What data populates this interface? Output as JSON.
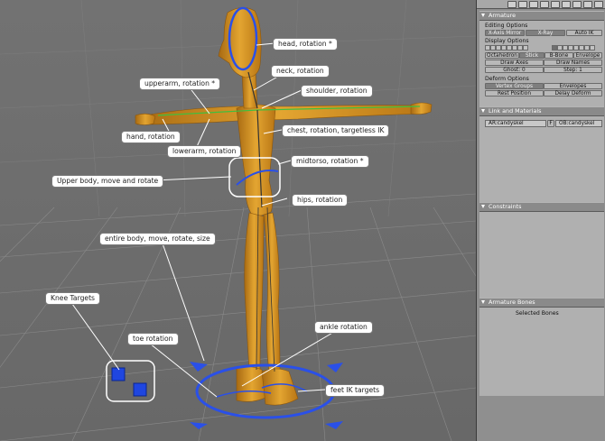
{
  "callouts": {
    "head": "head, rotation *",
    "neck": "neck, rotation",
    "upperarm": "upperarm, rotation *",
    "shoulder": "shoulder, rotation",
    "hand": "hand, rotation",
    "chest": "chest, rotation, targetless IK",
    "lowerarm": "lowerarm, rotation",
    "midtorso": "midtorso, rotation *",
    "upper_body": "Upper body, move and rotate",
    "hips": "hips, rotation",
    "entire_body": "entire body, move, rotate, size",
    "knee_targets": "Knee Targets",
    "ankle": "ankle rotation",
    "toe": "toe rotation",
    "feet_ik": "feet IK targets"
  },
  "panel": {
    "armature": {
      "title": "Armature",
      "editing_options": "Editing Options",
      "x_axis_mirror": "X-Axis Mirror",
      "x_ray": "X-Ray",
      "auto_ik": "Auto IK",
      "display_options": "Display Options",
      "octahedron": "Octahedron",
      "stick": "Stick",
      "b_bone": "B-Bone",
      "envelope": "Envelope",
      "draw_axes": "Draw Axes",
      "draw_names": "Draw Names",
      "ghost": "Ghost: 0",
      "step": "Step: 1",
      "deform_options": "Deform Options",
      "vertex_groups": "Vertex Groups",
      "envelopes": "Envelopes",
      "rest_position": "Rest Position",
      "delay_deform": "Delay Deform"
    },
    "link_materials": {
      "title": "Link and Materials",
      "ar_field": "AR:candyskel",
      "f_label": "F",
      "ob_field": "OB:candyskel"
    },
    "constraints": {
      "title": "Constraints"
    },
    "armature_bones": {
      "title": "Armature Bones",
      "selected_bones": "Selected Bones"
    }
  },
  "colors": {
    "figure": "#d6931c",
    "bone": "#2244cc",
    "selection": "#2a50e8",
    "panel_bg": "#b0b0b0"
  }
}
